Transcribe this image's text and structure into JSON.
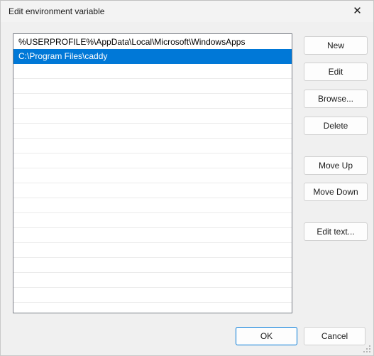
{
  "window": {
    "title": "Edit environment variable",
    "close_icon": "close-icon",
    "close_glyph": "✕"
  },
  "colors": {
    "selection": "#0078D7",
    "accent_border": "#0078D7",
    "dialog_background": "#F0F0F0",
    "titlebar_background": "#F3F3F3",
    "listbox_background": "#FFFFFF",
    "listbox_border": "#7A7E87",
    "row_separator": "#EBEBEB"
  },
  "list": {
    "entries": [
      {
        "value": "%USERPROFILE%\\AppData\\Local\\Microsoft\\WindowsApps",
        "selected": false
      },
      {
        "value": "C:\\Program Files\\caddy",
        "selected": true
      }
    ],
    "empty_row_count": 17
  },
  "side_buttons": [
    {
      "label": "New",
      "name": "new-button"
    },
    {
      "label": "Edit",
      "name": "edit-button"
    },
    {
      "label": "Browse...",
      "name": "browse-button"
    },
    {
      "label": "Delete",
      "name": "delete-button"
    },
    {
      "label": "Move Up",
      "name": "move-up-button"
    },
    {
      "label": "Move Down",
      "name": "move-down-button"
    },
    {
      "label": "Edit text...",
      "name": "edit-text-button"
    }
  ],
  "bottom_buttons": {
    "ok": "OK",
    "cancel": "Cancel"
  }
}
